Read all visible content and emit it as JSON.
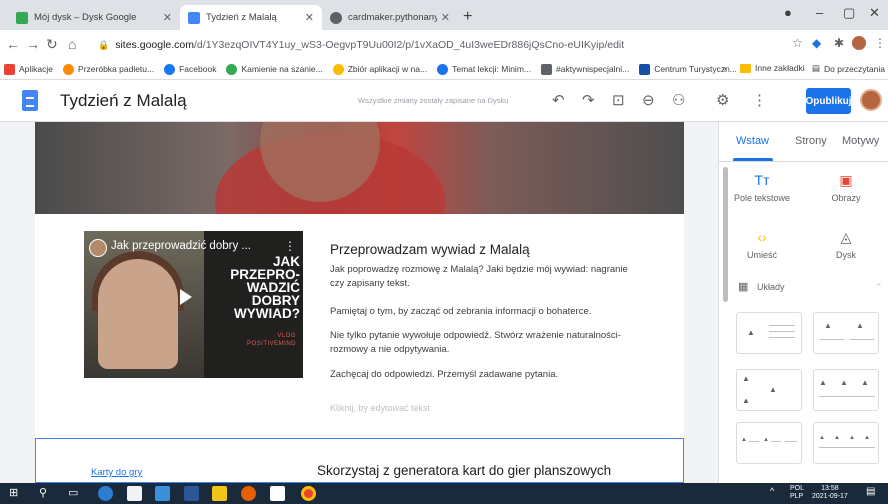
{
  "browser": {
    "tabs": [
      {
        "title": "Mój dysk – Dysk Google",
        "color": "#34a853"
      },
      {
        "title": "Tydzień z Malalą",
        "color": "#4285f4"
      },
      {
        "title": "cardmaker.pythonanywhere.com",
        "color": "#5f6368"
      }
    ],
    "new_tab": "+",
    "window_controls": {
      "minimize": "–",
      "maximize": "▢",
      "close": "✕"
    },
    "url": {
      "host": "sites.google.com",
      "path": "/d/1Y3ezqOIVT4Y1uy_wS3-OegvpT9Uu00I2/p/1vXaOD_4uI3weEDr886jQsCno-eUIKyip/edit"
    },
    "bookmarks": [
      {
        "label": "Aplikacje",
        "color": "#ea4335"
      },
      {
        "label": "Przeróbka padletu...",
        "color": "#fb8c00"
      },
      {
        "label": "Facebook",
        "color": "#1877f2"
      },
      {
        "label": "Kamienie na szanie...",
        "color": "#34a853"
      },
      {
        "label": "Zbiór aplikacji w na...",
        "color": "#fbbc04"
      },
      {
        "label": "Temat lekcji: Minim...",
        "color": "#1a73e8"
      },
      {
        "label": "#aktywnispecjalni...",
        "color": "#5f6368"
      },
      {
        "label": "Centrum Turystyczn...",
        "color": "#174ea6"
      }
    ],
    "bookmarks_more": "»",
    "other_bookmarks": "Inne zakładki",
    "reading_list": "Do przeczytania"
  },
  "editor": {
    "site_title": "Tydzień z Malalą",
    "save_status": "Wszystkie zmiany zostały zapisane na Dysku",
    "publish_label": "Opublikuj"
  },
  "content": {
    "video": {
      "title": "Jak przeprowadzić dobry ...",
      "menu": "⋮",
      "overlay_lines": [
        "JAK",
        "PRZEPRO-",
        "WADZIĆ",
        "DOBRY",
        "WYWIAD?"
      ],
      "overlay_tag": "VLOG POSITIVEMIND"
    },
    "article_title": "Przeprowadzam wywiad z Malalą",
    "paragraphs": [
      "Jak poprowadzę rozmowę z Malalą? Jaki będzie mój wywiad: nagranie czy zapisany tekst.",
      "Pamiętaj o tym, by zacząć od zebrania informacji o bohaterce.",
      "Nie tylko pytanie wywołuje odpowiedź. Stwórz wrażenie naturalności- rozmowy a nie odpytywania.",
      "Zachęcaj do odpowiedzi. Przemyśl zadawane pytania."
    ],
    "placeholder": "Kliknij, by edytować tekst",
    "section2_link": "Karty do gry",
    "section2_title": "Skorzystaj z generatora kart do gier planszowych"
  },
  "sidebar": {
    "tabs": [
      "Wstaw",
      "Strony",
      "Motywy"
    ],
    "items": [
      {
        "label": "Pole tekstowe",
        "icon": "Tт",
        "color": "#1a73e8"
      },
      {
        "label": "Obrazy",
        "icon": "▣",
        "color": "#ea4335"
      },
      {
        "label": "Umieść",
        "icon": "‹›",
        "color": "#fbbc04"
      },
      {
        "label": "Dysk",
        "icon": "◬",
        "color": "#5f6368"
      }
    ],
    "layouts_label": "Układy"
  },
  "taskbar": {
    "lang": [
      "POL",
      "PLP"
    ],
    "time": "13:58",
    "date": "2021-09-17"
  }
}
